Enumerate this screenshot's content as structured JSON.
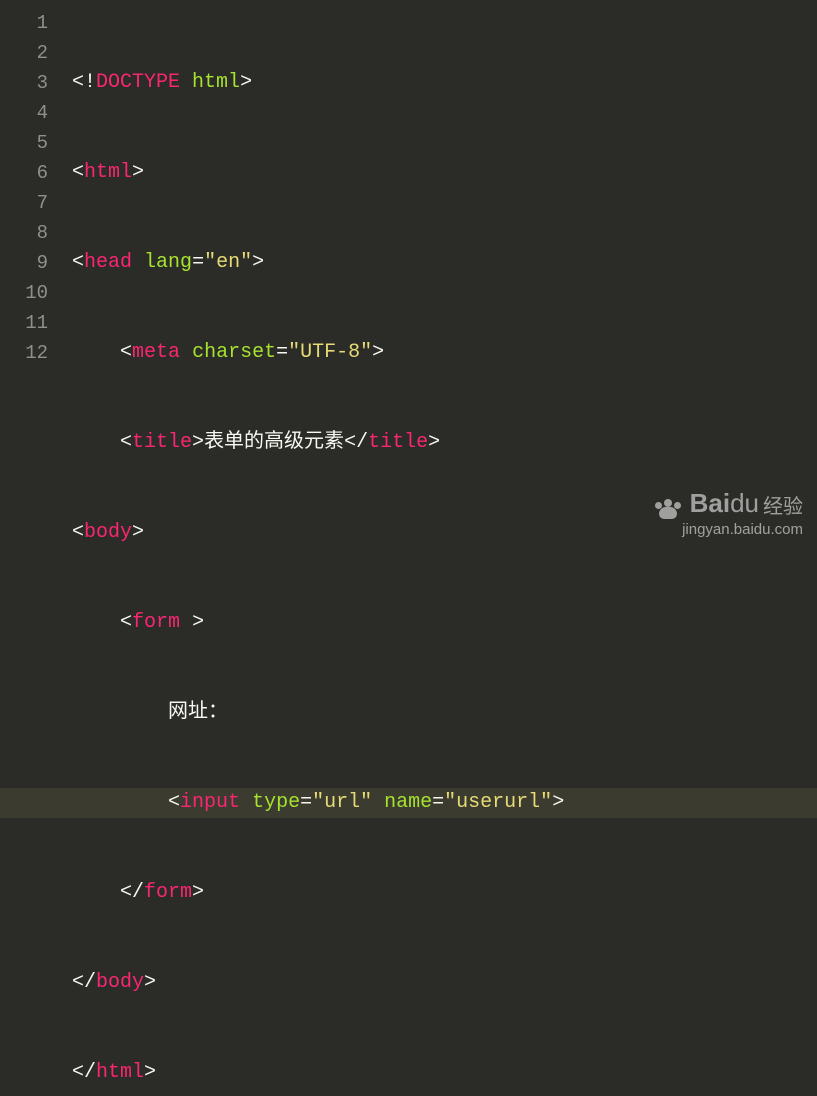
{
  "gutter": [
    "1",
    "2",
    "3",
    "4",
    "5",
    "6",
    "7",
    "8",
    "9",
    "10",
    "11",
    "12"
  ],
  "highlightedLine": 9,
  "tokens": {
    "lt": "<",
    "gt": ">",
    "ltSlash": "</",
    "sp": " ",
    "eq": "=",
    "bang": "!",
    "doctype": "DOCTYPE",
    "docHtml": " html",
    "html": "html",
    "head": "head",
    "lang": "lang",
    "langVal": "\"en\"",
    "meta": "meta",
    "charset": "charset",
    "charsetVal": "\"UTF-8\"",
    "title": "title",
    "titleText": "表单的高级元素",
    "body": "body",
    "form": "form",
    "labelText": "网址：",
    "input": "input",
    "type": "type",
    "typeVal": "\"url\"",
    "name": "name",
    "nameVal": "\"userurl\""
  },
  "indent": {
    "i0": "",
    "i1": "    ",
    "i2": "        ",
    "i3": "            "
  },
  "watermark": {
    "brand": "Bai",
    "brandSuffix": "du",
    "label": "经验",
    "url": "jingyan.baidu.com"
  }
}
